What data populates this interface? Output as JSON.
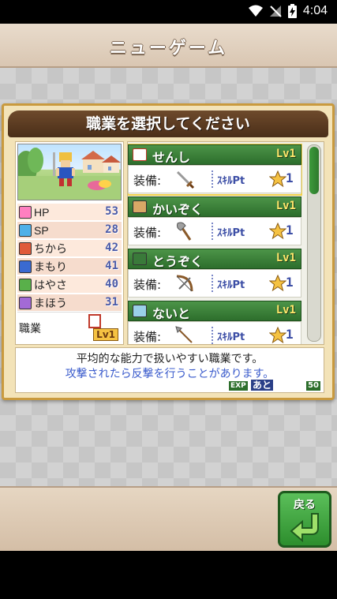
{
  "status_bar": {
    "time": "4:04"
  },
  "screen_title": "ニューゲーム",
  "dialog": {
    "title": "職業を選択してください",
    "stats": [
      {
        "icon": "heart-icon",
        "label": "HP",
        "value": "53",
        "color": "#ff7fc0"
      },
      {
        "icon": "diamond-icon",
        "label": "SP",
        "value": "28",
        "color": "#4fb0e8"
      },
      {
        "icon": "sword-icon",
        "label": "ちから",
        "value": "42",
        "color": "#e05a3a"
      },
      {
        "icon": "shield-icon",
        "label": "まもり",
        "value": "41",
        "color": "#3a6ad0"
      },
      {
        "icon": "boot-icon",
        "label": "はやさ",
        "value": "40",
        "color": "#59b04a"
      },
      {
        "icon": "magic-icon",
        "label": "まほう",
        "value": "31",
        "color": "#a36ad6"
      }
    ],
    "job_label": "職業",
    "job_level": "Lv1",
    "jobs": [
      {
        "name": "せんし",
        "level": "Lv1",
        "equip_label": "装備:",
        "skill_label": "ｽｷﾙPt",
        "skill_points": "1",
        "weapon": "sword-icon",
        "selected": true
      },
      {
        "name": "かいぞく",
        "level": "Lv1",
        "equip_label": "装備:",
        "skill_label": "ｽｷﾙPt",
        "skill_points": "1",
        "weapon": "axe-icon",
        "selected": false
      },
      {
        "name": "とうぞく",
        "level": "Lv1",
        "equip_label": "装備:",
        "skill_label": "ｽｷﾙPt",
        "skill_points": "1",
        "weapon": "bow-icon",
        "selected": false
      },
      {
        "name": "ないと",
        "level": "Lv1",
        "equip_label": "装備:",
        "skill_label": "ｽｷﾙPt",
        "skill_points": "1",
        "weapon": "spear-icon",
        "selected": false
      }
    ],
    "description_line1": "平均的な能力で扱いやすい職業です。",
    "description_line2": "攻撃されたら反撃を行うことがあります。",
    "exp_label": "EXP",
    "exp_remaining_label": "あと",
    "exp_value": "50"
  },
  "back_button": {
    "label": "戻る"
  },
  "colors": {
    "job_header": "#3a8a38",
    "dialog_header": "#5a3a22",
    "panel_bg": "#f3e3b8"
  }
}
